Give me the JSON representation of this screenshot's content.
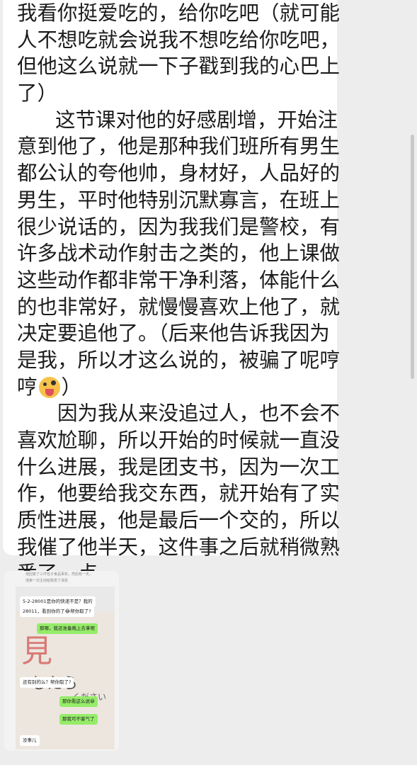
{
  "message": {
    "lines": [
      "我看你挺爱吃的，给你吃吧（就可能",
      "人不想吃就会说我不想吃给你吃吧，",
      "但他这么说就一下子戳到我的心巴上",
      "了）",
      "这节课对他的好感剧增，开始注",
      "意到他了，他是那种我们班所有男生",
      "都公认的夸他帅，身材好，人品好的",
      "男生，平时他特别沉默寡言，在班上",
      "很少说话的，因为我我们是警校，有",
      "许多战术动作射击之类的，他上课做",
      "这些动作都非常干净利落，体能什么",
      "的也非常好，就慢慢喜欢上他了，就",
      "决定要追他了。（后来他告诉我因为",
      "是我，所以才这么说的，被骗了呢哼",
      "哼",
      "）",
      "因为我从来没追过人，也不会不",
      "喜欢尬聊，所以开始的时候就一直没",
      "什么进展，我是团支书，因为一次工",
      "作，他要给我交东西，就开始有了实",
      "质性进展，他是最后一个交的，所以",
      "我催了他半天，这件事之后就稍微熟",
      "悉了一点"
    ],
    "emoji_icon": "crazy-face-emoji"
  },
  "image_message": {
    "top_lines": [
      "他回答了三件包子食品事实，然后有一天，",
      "他第一次主动给我发了消息"
    ],
    "photo_text": {
      "kanji": "見",
      "kana": "したら",
      "kana_small": "ください"
    },
    "chat": [
      {
        "side": "left",
        "text": "5-2-28001是你的快递不是？我的"
      },
      {
        "side": "left",
        "text": "28011，看到你的了😂帮你取了?"
      },
      {
        "side": "right",
        "text": "那哪，我还准备晚上去拿呢"
      },
      {
        "side": "left",
        "text": "还有别的么？帮你取了?"
      },
      {
        "side": "right",
        "text": "那你看这么说😀"
      },
      {
        "side": "right",
        "text": "那我可不客气了"
      },
      {
        "side": "left",
        "text": "没事儿"
      }
    ]
  },
  "colors": {
    "page_bg": "#ededed",
    "bubble_bg": "#ffffff",
    "sent_bubble": "#95ec69"
  }
}
